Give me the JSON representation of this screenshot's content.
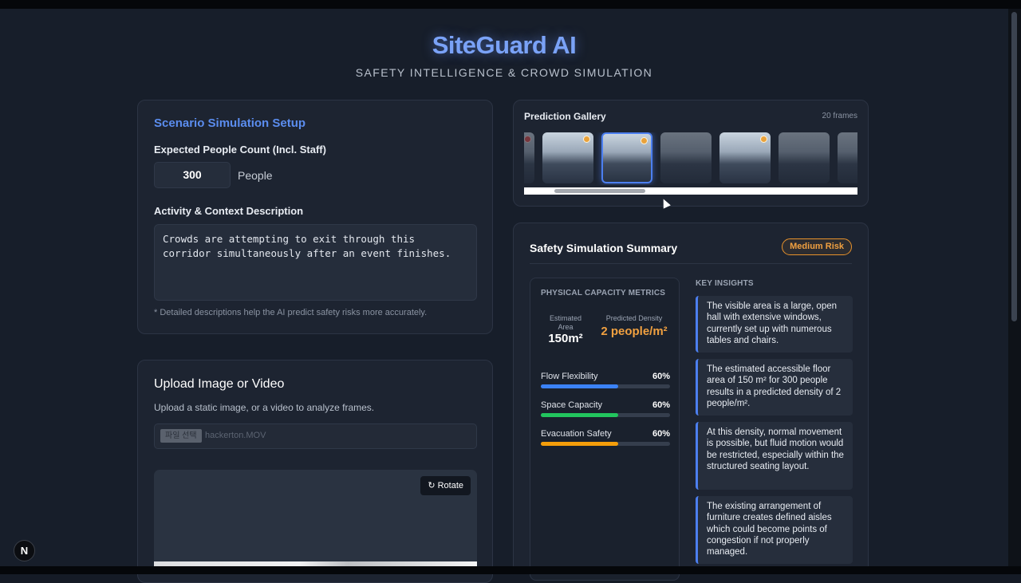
{
  "app": {
    "title": "SiteGuard AI",
    "subtitle": "SAFETY INTELLIGENCE & CROWD SIMULATION"
  },
  "setup": {
    "title": "Scenario Simulation Setup",
    "people_label": "Expected People Count (Incl. Staff)",
    "people_value": "300",
    "people_unit": "People",
    "desc_label": "Activity & Context Description",
    "desc_value": "Crowds are attempting to exit through this corridor simultaneously after an event finishes.",
    "hint": "* Detailed descriptions help the AI predict safety risks more accurately."
  },
  "upload": {
    "title": "Upload Image or Video",
    "description": "Upload a static image, or a video to analyze frames.",
    "file_button": "파일 선택",
    "file_name": "hackerton.MOV",
    "rotate_label": "↻ Rotate"
  },
  "gallery": {
    "title": "Prediction Gallery",
    "count": "20 frames",
    "thumbs": [
      {
        "dot": "red",
        "state": "dim"
      },
      {
        "dot": "orange",
        "state": "normal"
      },
      {
        "dot": "orange",
        "state": "selected"
      },
      {
        "dot": "none",
        "state": "dim"
      },
      {
        "dot": "orange",
        "state": "normal"
      },
      {
        "dot": "none",
        "state": "dim"
      },
      {
        "dot": "none",
        "state": "dim"
      }
    ]
  },
  "summary": {
    "title": "Safety Simulation Summary",
    "risk": "Medium Risk",
    "risk_color": "#e8922b",
    "metrics_title": "PHYSICAL CAPACITY METRICS",
    "area_label": "Estimated Area",
    "area_value": "150m²",
    "density_label": "Predicted Density",
    "density_value": "2 people/m²",
    "bars": [
      {
        "name": "Flow Flexibility",
        "pct_label": "60%",
        "value": 0.6,
        "color": "#3b82f6"
      },
      {
        "name": "Space Capacity",
        "pct_label": "60%",
        "value": 0.6,
        "color": "#22c55e"
      },
      {
        "name": "Evacuation Safety",
        "pct_label": "60%",
        "value": 0.6,
        "color": "#f59e0b"
      }
    ],
    "insights_title": "KEY INSIGHTS",
    "insights": [
      "The visible area is a large, open hall with extensive windows, currently set up with numerous tables and chairs.",
      "The estimated accessible floor area of 150 m² for 300 people results in a predicted density of 2 people/m².",
      "At this density, normal movement is possible, but fluid motion would be restricted, especially within the structured seating layout.",
      "The existing arrangement of furniture creates defined aisles which could become points of congestion if not properly managed."
    ]
  },
  "badge": "N"
}
